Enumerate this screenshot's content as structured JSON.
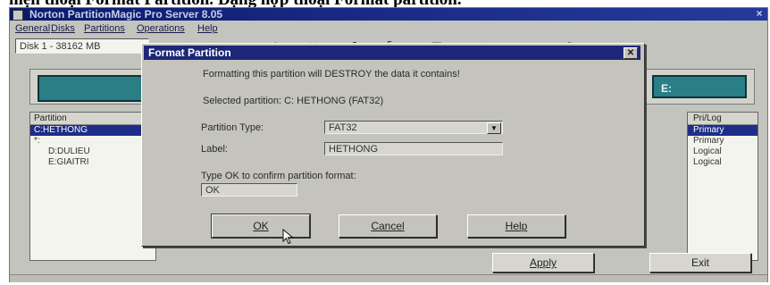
{
  "caption": "hiện thoại Format Partition. Đặng hợp thoại Format partition.",
  "app": {
    "title": "Norton PartitionMagic Pro Server 8.05",
    "close_glyph": "×",
    "menu": [
      "General",
      "Disks",
      "Partitions",
      "Operations",
      "Help"
    ],
    "disk_select": "Disk 1 - 38162 MB",
    "disk_right_label": "E:",
    "list_left_header": "Partition",
    "list_left_rows": [
      "C:HETHONG",
      "*:",
      "D:DULIEU",
      "E:GIAITRI"
    ],
    "list_right_header": "Pri/Log",
    "list_right_rows": [
      "Primary",
      "Primary",
      "Logical",
      "Logical"
    ],
    "apply_label": "Apply",
    "exit_label": "Exit"
  },
  "dialog": {
    "title": "Format Partition",
    "warning": "Formatting this partition will DESTROY the data it contains!",
    "selected": "Selected partition: C: HETHONG (FAT32)",
    "partition_type_label": "Partition Type:",
    "partition_type_value": "FAT32",
    "label_label": "Label:",
    "label_value": "HETHONG",
    "confirm_label": "Type OK to confirm partition format:",
    "confirm_value": "OK",
    "ok_label": "OK",
    "cancel_label": "Cancel",
    "help_label": "Help"
  }
}
